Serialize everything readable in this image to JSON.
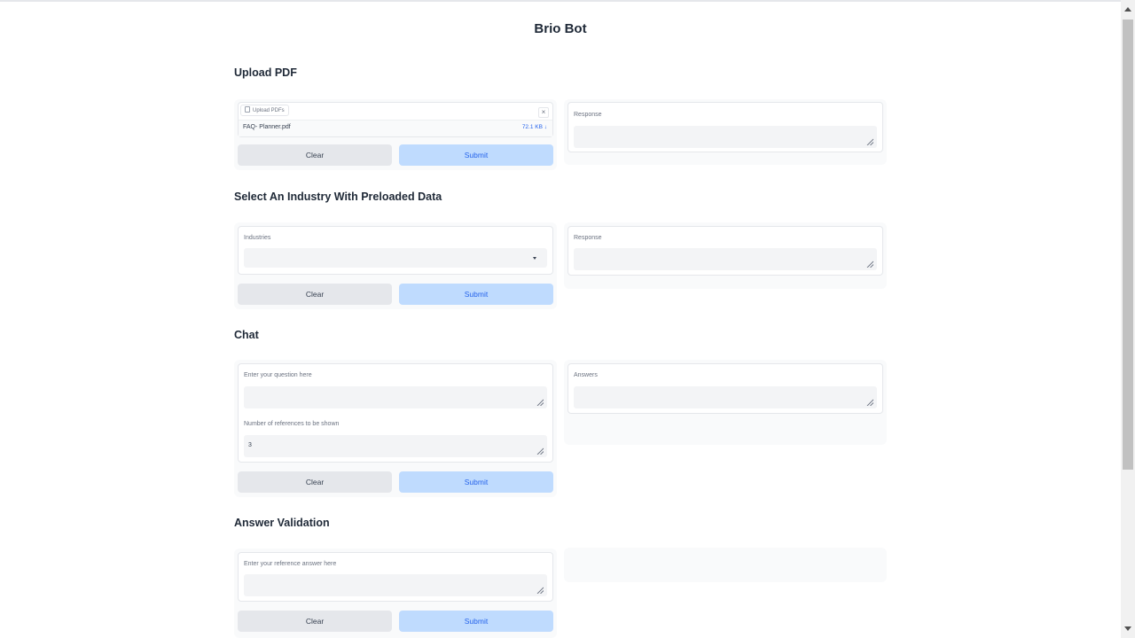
{
  "app": {
    "title": "Brio Bot"
  },
  "upload": {
    "heading": "Upload PDF",
    "tab_label": "Upload PDFs",
    "file_name": "FAQ- Planner.pdf",
    "file_size": "72.1 KB ↓",
    "clear": "Clear",
    "submit": "Submit",
    "response_label": "Response"
  },
  "industry": {
    "heading": "Select An Industry With Preloaded Data",
    "dropdown_label": "Industries",
    "clear": "Clear",
    "submit": "Submit",
    "response_label": "Response"
  },
  "chat": {
    "heading": "Chat",
    "question_label": "Enter your question here",
    "refs_label": "Number of references to be shown",
    "refs_value": "3",
    "clear": "Clear",
    "submit": "Submit",
    "answers_label": "Answers"
  },
  "validation": {
    "heading": "Answer Validation",
    "reference_label": "Enter your reference answer here",
    "clear": "Clear",
    "submit": "Submit"
  },
  "colors": {
    "submit_bg": "#bfdbfe",
    "submit_text": "#2563eb",
    "clear_bg": "#e5e7eb"
  }
}
